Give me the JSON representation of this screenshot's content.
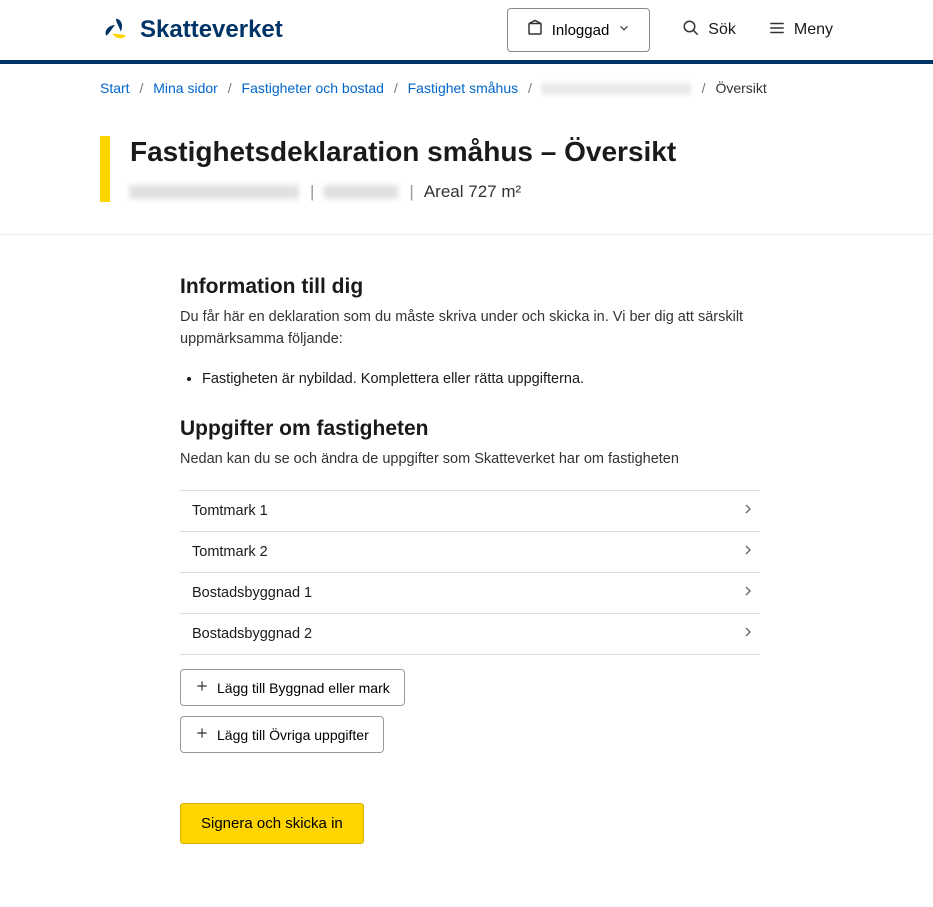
{
  "header": {
    "brand": "Skatteverket",
    "logged_in_label": "Inloggad",
    "search_label": "Sök",
    "menu_label": "Meny"
  },
  "breadcrumb": {
    "items": [
      {
        "label": "Start"
      },
      {
        "label": "Mina sidor"
      },
      {
        "label": "Fastigheter och bostad"
      },
      {
        "label": "Fastighet småhus"
      }
    ],
    "current": "Översikt"
  },
  "page": {
    "title": "Fastighetsdeklaration småhus – Översikt",
    "areal_label": "Areal 727 m²"
  },
  "info_section": {
    "heading": "Information till dig",
    "text": "Du får här en deklaration som du måste skriva under och skicka in. Vi ber dig att särskilt uppmärksamma följande:",
    "bullets": [
      "Fastigheten är nybildad. Komplettera eller rätta uppgifterna."
    ]
  },
  "properties_section": {
    "heading": "Uppgifter om fastigheten",
    "text": "Nedan kan du se och ändra de uppgifter som Skatteverket har om fastigheten",
    "items": [
      {
        "label": "Tomtmark 1"
      },
      {
        "label": "Tomtmark 2"
      },
      {
        "label": "Bostadsbyggnad 1"
      },
      {
        "label": "Bostadsbyggnad 2"
      }
    ]
  },
  "actions": {
    "add_building_label": "Lägg till Byggnad eller mark",
    "add_other_label": "Lägg till Övriga uppgifter",
    "submit_label": "Signera och skicka in"
  }
}
